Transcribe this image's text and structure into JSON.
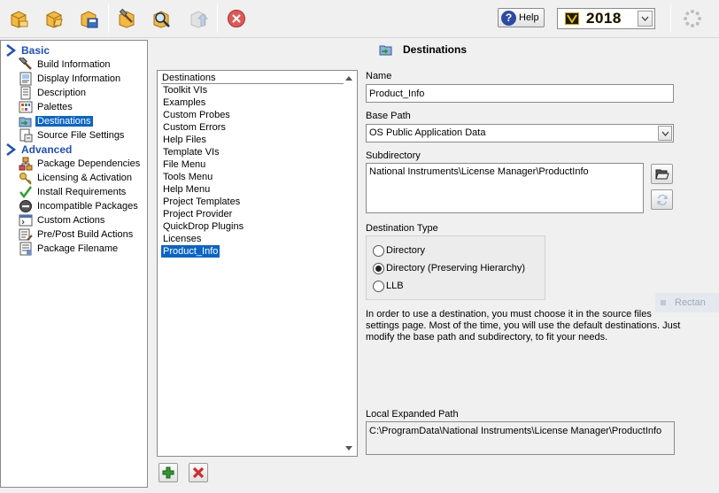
{
  "toolbar": {
    "buttons": [
      {
        "name": "new-icon"
      },
      {
        "name": "open-icon"
      },
      {
        "name": "save-icon"
      },
      {
        "name": "build-icon"
      },
      {
        "name": "preview-icon"
      },
      {
        "name": "deploy-icon"
      },
      {
        "name": "close-icon"
      }
    ],
    "help_label": "Help",
    "version_label": "2018"
  },
  "nav": {
    "sections": [
      {
        "label": "Basic",
        "icon": "chevron-right-icon"
      },
      {
        "label": "Advanced",
        "icon": "chevron-right-icon"
      }
    ],
    "items": [
      {
        "label": "Build Information",
        "icon": "hammer-icon"
      },
      {
        "label": "Display Information",
        "icon": "display-icon"
      },
      {
        "label": "Description",
        "icon": "document-icon"
      },
      {
        "label": "Palettes",
        "icon": "palette-icon"
      },
      {
        "label": "Destinations",
        "icon": "folder-arrow-icon",
        "selected": true
      },
      {
        "label": "Source File Settings",
        "icon": "file-settings-icon"
      },
      {
        "label": "Package Dependencies",
        "icon": "dependencies-icon"
      },
      {
        "label": "Licensing & Activation",
        "icon": "key-icon"
      },
      {
        "label": "Install Requirements",
        "icon": "checkmark-icon"
      },
      {
        "label": "Incompatible Packages",
        "icon": "no-entry-icon"
      },
      {
        "label": "Custom Actions",
        "icon": "script-icon"
      },
      {
        "label": "Pre/Post Build Actions",
        "icon": "build-actions-icon"
      },
      {
        "label": "Package Filename",
        "icon": "filename-icon"
      }
    ]
  },
  "page_title": "Destinations",
  "list": {
    "header": "Destinations",
    "items": [
      "Toolkit VIs",
      "Examples",
      "Custom Probes",
      "Custom Errors",
      "Help Files",
      "Template VIs",
      "File Menu",
      "Tools Menu",
      "Help Menu",
      "Project Templates",
      "Project Provider",
      "QuickDrop Plugins",
      "Licenses",
      "Product_Info"
    ],
    "selected": "Product_Info"
  },
  "form": {
    "name_label": "Name",
    "name_value": "Product_Info",
    "base_path_label": "Base Path",
    "base_path_value": "OS Public Application Data",
    "subdirectory_label": "Subdirectory",
    "subdirectory_value": "National Instruments\\License Manager\\ProductInfo",
    "destination_type_label": "Destination Type",
    "destination_types": [
      {
        "label": "Directory",
        "selected": false
      },
      {
        "label": "Directory (Preserving Hierarchy)",
        "selected": true
      },
      {
        "label": "LLB",
        "selected": false
      }
    ],
    "help_text": "In order to use a destination, you must choose it in the source files settings page. Most of the time, you will use the default  destinations. Just modify the base path and subdirectory, to fit your needs.",
    "local_path_label": "Local Expanded Path",
    "local_path_value": "C:\\ProgramData\\National Instruments\\License Manager\\ProductInfo"
  },
  "ghost_label": "Rectan",
  "colors": {
    "selection": "#0a64c8",
    "section_header": "#1d4fbf",
    "add_green": "#2e9a2e",
    "delete_red": "#d02c2c"
  }
}
